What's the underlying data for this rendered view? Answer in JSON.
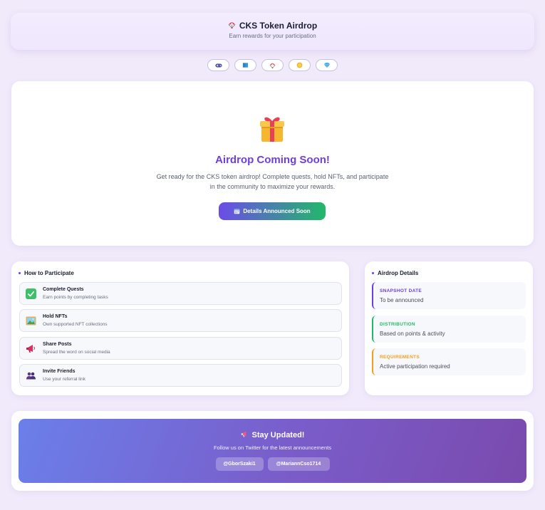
{
  "header": {
    "title": "CKS Token Airdrop",
    "subtitle": "Earn rewards for your participation",
    "icon": "parachute-icon"
  },
  "nav": [
    {
      "icon": "gamepad-icon"
    },
    {
      "icon": "book-icon"
    },
    {
      "icon": "parachute-icon"
    },
    {
      "icon": "coin-icon"
    },
    {
      "icon": "diamond-icon"
    }
  ],
  "hero": {
    "icon": "gift-icon",
    "title": "Airdrop Coming Soon!",
    "description": "Get ready for the CKS token airdrop! Complete quests, hold NFTs, and participate in the community to maximize your rewards.",
    "cta_label": "Details Announced Soon",
    "cta_icon": "calendar-icon"
  },
  "participate": {
    "heading": "How to Participate",
    "items": [
      {
        "title": "Complete Quests",
        "desc": "Earn points by completing tasks",
        "icon": "checkbox-icon"
      },
      {
        "title": "Hold NFTs",
        "desc": "Own supported NFT collections",
        "icon": "picture-icon"
      },
      {
        "title": "Share Posts",
        "desc": "Spread the word on social media",
        "icon": "megaphone-icon"
      },
      {
        "title": "Invite Friends",
        "desc": "Use your referral link",
        "icon": "users-icon"
      }
    ]
  },
  "details": {
    "heading": "Airdrop Details",
    "items": [
      {
        "label": "SNAPSHOT DATE",
        "value": "To be announced",
        "color": "#6d3fe0"
      },
      {
        "label": "DISTRIBUTION",
        "value": "Based on points & activity",
        "color": "#22b86a"
      },
      {
        "label": "REQUIREMENTS",
        "value": "Active participation required",
        "color": "#f0a020"
      }
    ]
  },
  "updates": {
    "title": "Stay Updated!",
    "subtitle": "Follow us on Twitter for the latest announcements",
    "icon": "megaphone-icon",
    "handles": [
      "@GborSzaki1",
      "@MariannCso1714"
    ]
  },
  "colors": {
    "accent": "#6d3fe0",
    "green": "#22b86a",
    "orange": "#f0a020",
    "background": "#f1eafb"
  }
}
